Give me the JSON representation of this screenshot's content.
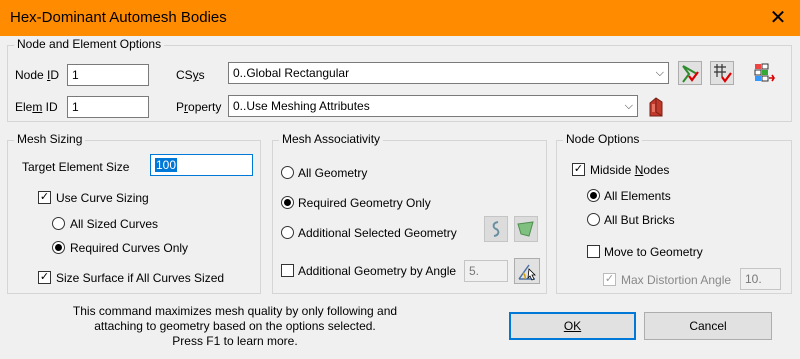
{
  "title": "Hex-Dominant Automesh Bodies",
  "node_elem": {
    "legend": "Node and Element Options",
    "node_id_label_pre": "Node ",
    "node_id_label_u": "I",
    "node_id_label_post": "D",
    "node_id": "1",
    "elem_id_label_pre": "Ele",
    "elem_id_label_u": "m",
    "elem_id_label_post": " ID",
    "elem_id": "1",
    "csys_label_pre": "CS",
    "csys_label_u": "y",
    "csys_label_post": "s",
    "csys_value": "0..Global Rectangular",
    "property_label_pre": "P",
    "property_label_u": "r",
    "property_label_post": "operty",
    "property_value": "0..Use Meshing Attributes"
  },
  "mesh_sizing": {
    "legend": "Mesh Sizing",
    "target_label": "Target Element Size",
    "target_value": "100",
    "use_curve_sizing": "Use Curve Sizing",
    "all_sized_curves": "All Sized Curves",
    "required_curves_only": "Required Curves Only",
    "size_surface": "Size Surface if All Curves Sized"
  },
  "mesh_assoc": {
    "legend": "Mesh Associativity",
    "all_geometry": "All Geometry",
    "required_geometry_only": "Required Geometry Only",
    "additional_selected": "Additional Selected Geometry",
    "additional_by_angle": "Additional Geometry by Angle",
    "angle_value": "5."
  },
  "node_options": {
    "legend": "Node Options",
    "midside_pre": "Midside ",
    "midside_u": "N",
    "midside_post": "odes",
    "all_elements": "All Elements",
    "all_but_bricks": "All But Bricks",
    "move_to_geometry": "Move to Geometry",
    "max_distortion": "Max Distortion Angle",
    "max_distortion_value": "10."
  },
  "info_text": [
    "This command maximizes mesh quality by only following and",
    "attaching to geometry based on the options selected.",
    "Press F1 to learn more."
  ],
  "buttons": {
    "ok": "OK",
    "cancel": "Cancel"
  },
  "icons": {
    "close": "close-icon",
    "coordsys_check": "coordinate-system-check-icon",
    "grid_check": "mesh-grid-check-icon",
    "grid_multi": "mesh-grid-list-icon",
    "property": "property-icon",
    "curve": "curve-select-icon",
    "surface": "surface-select-icon",
    "angle_pick": "angle-pick-icon"
  },
  "colors": {
    "accent_title": "#ff8c00",
    "focus": "#0078d7"
  }
}
